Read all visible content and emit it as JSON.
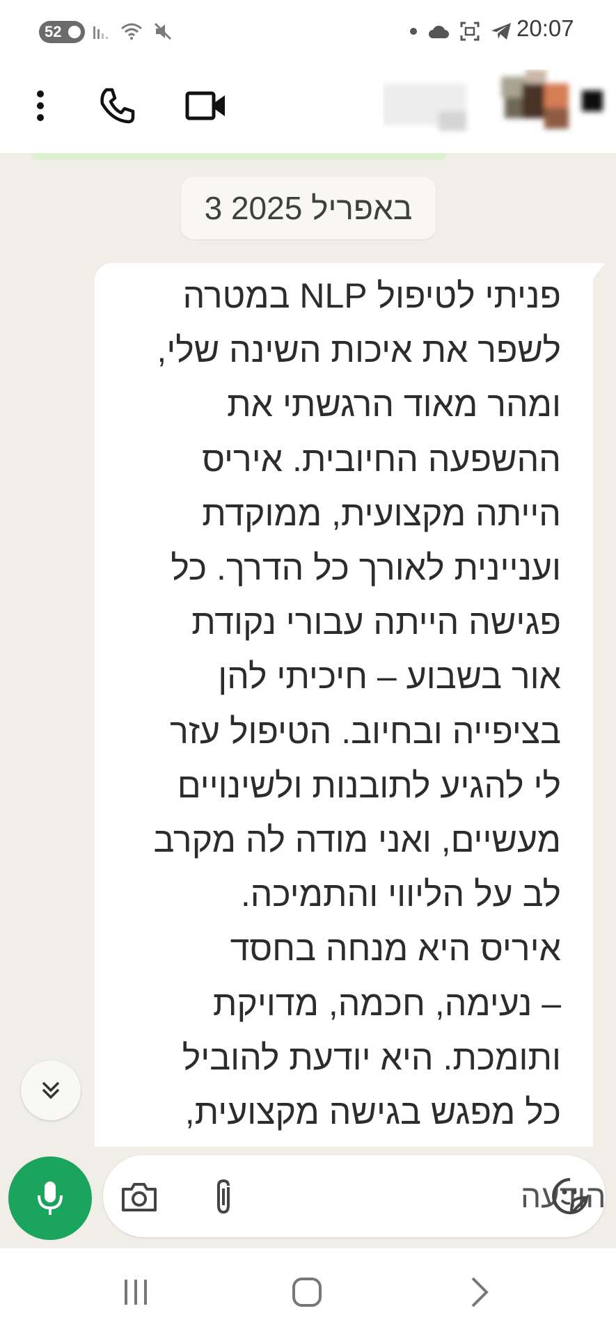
{
  "status_bar": {
    "battery": "52",
    "time": "20:07"
  },
  "header": {
    "icons": [
      "more-vert-icon",
      "phone-icon",
      "video-camera-icon"
    ]
  },
  "chat": {
    "date_chip": "3 באפריל 2025",
    "message": "פניתי לטיפול NLP במטרה\nלשפר את איכות השינה שלי,\nומהר מאוד הרגשתי את\nההשפעה החיובית. איריס\nהייתה מקצועית, ממוקדת\nועניינית לאורך כל הדרך. כל\nפגישה הייתה עבורי נקודת\nאור בשבוע – חיכיתי להן\nבציפייה ובחיוב. הטיפול עזר\nלי להגיע לתובנות ולשינויים\nמעשיים, ואני מודה לה מקרב\nלב על הליווי והתמיכה.\nאיריס היא מנחה בחסד\n– נעימה, חכמה, מדויקת\nותומכת. היא יודעת להוביל\nכל מפגש בגישה מקצועית,\nממוקדת ויעילה, והמפגשים"
  },
  "composer": {
    "placeholder": "הודעה"
  },
  "colors": {
    "accent_green": "#1aa45e",
    "chat_background": "#f1eee8",
    "bubble": "#ffffff"
  }
}
